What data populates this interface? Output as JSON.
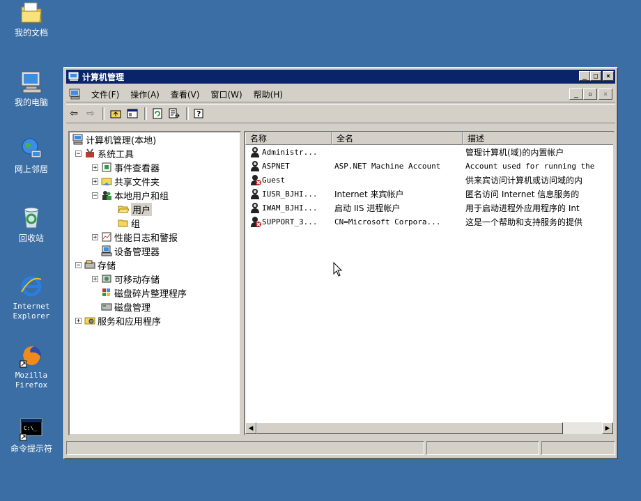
{
  "desktop": {
    "icons": [
      {
        "label": "我的文档",
        "icon": "my-documents-icon"
      },
      {
        "label": "我的电脑",
        "icon": "my-computer-icon"
      },
      {
        "label": "网上邻居",
        "icon": "network-places-icon"
      },
      {
        "label": "回收站",
        "icon": "recycle-bin-icon"
      },
      {
        "label": "Internet\nExplorer",
        "icon": "internet-explorer-icon"
      },
      {
        "label": "Mozilla\nFirefox",
        "icon": "firefox-icon"
      },
      {
        "label": "命令提示符",
        "icon": "command-prompt-icon"
      }
    ]
  },
  "window": {
    "title": "计算机管理",
    "menu": [
      "文件(F)",
      "操作(A)",
      "查看(V)",
      "窗口(W)",
      "帮助(H)"
    ],
    "toolbar": [
      "back-arrow-icon",
      "forward-arrow-icon",
      "up-folder-icon",
      "show-hide-tree-icon",
      "refresh-icon",
      "export-list-icon",
      "help-icon"
    ]
  },
  "tree": {
    "root": "计算机管理(本地)",
    "system_tools": "系统工具",
    "event_viewer": "事件查看器",
    "shared_folders": "共享文件夹",
    "local_users": "本地用户和组",
    "users": "用户",
    "groups": "组",
    "perf_logs": "性能日志和警报",
    "device_manager": "设备管理器",
    "storage": "存储",
    "removable": "可移动存储",
    "defrag": "磁盘碎片整理程序",
    "disk_mgmt": "磁盘管理",
    "services": "服务和应用程序"
  },
  "list": {
    "columns": [
      "名称",
      "全名",
      "描述"
    ],
    "rows": [
      {
        "name": "Administr...",
        "full": "",
        "desc": "管理计算机(域)的内置帐户",
        "disabled": false
      },
      {
        "name": "ASPNET",
        "full": "ASP.NET Machine Account",
        "desc": "Account used for running the",
        "disabled": false
      },
      {
        "name": "Guest",
        "full": "",
        "desc": "供来宾访问计算机或访问域的内",
        "disabled": true
      },
      {
        "name": "IUSR_BJHI...",
        "full": "Internet 来宾帐户",
        "desc": "匿名访问 Internet 信息服务的",
        "disabled": false
      },
      {
        "name": "IWAM_BJHI...",
        "full": "启动 IIS 进程帐户",
        "desc": "用于启动进程外应用程序的 Int",
        "disabled": false
      },
      {
        "name": "SUPPORT_3...",
        "full": "CN=Microsoft Corpora...",
        "desc": "这是一个帮助和支持服务的提供",
        "disabled": true
      }
    ]
  },
  "colors": {
    "desktop": "#3a6ea5",
    "titlebar": "#0a246a",
    "chrome": "#d4d0c8"
  }
}
